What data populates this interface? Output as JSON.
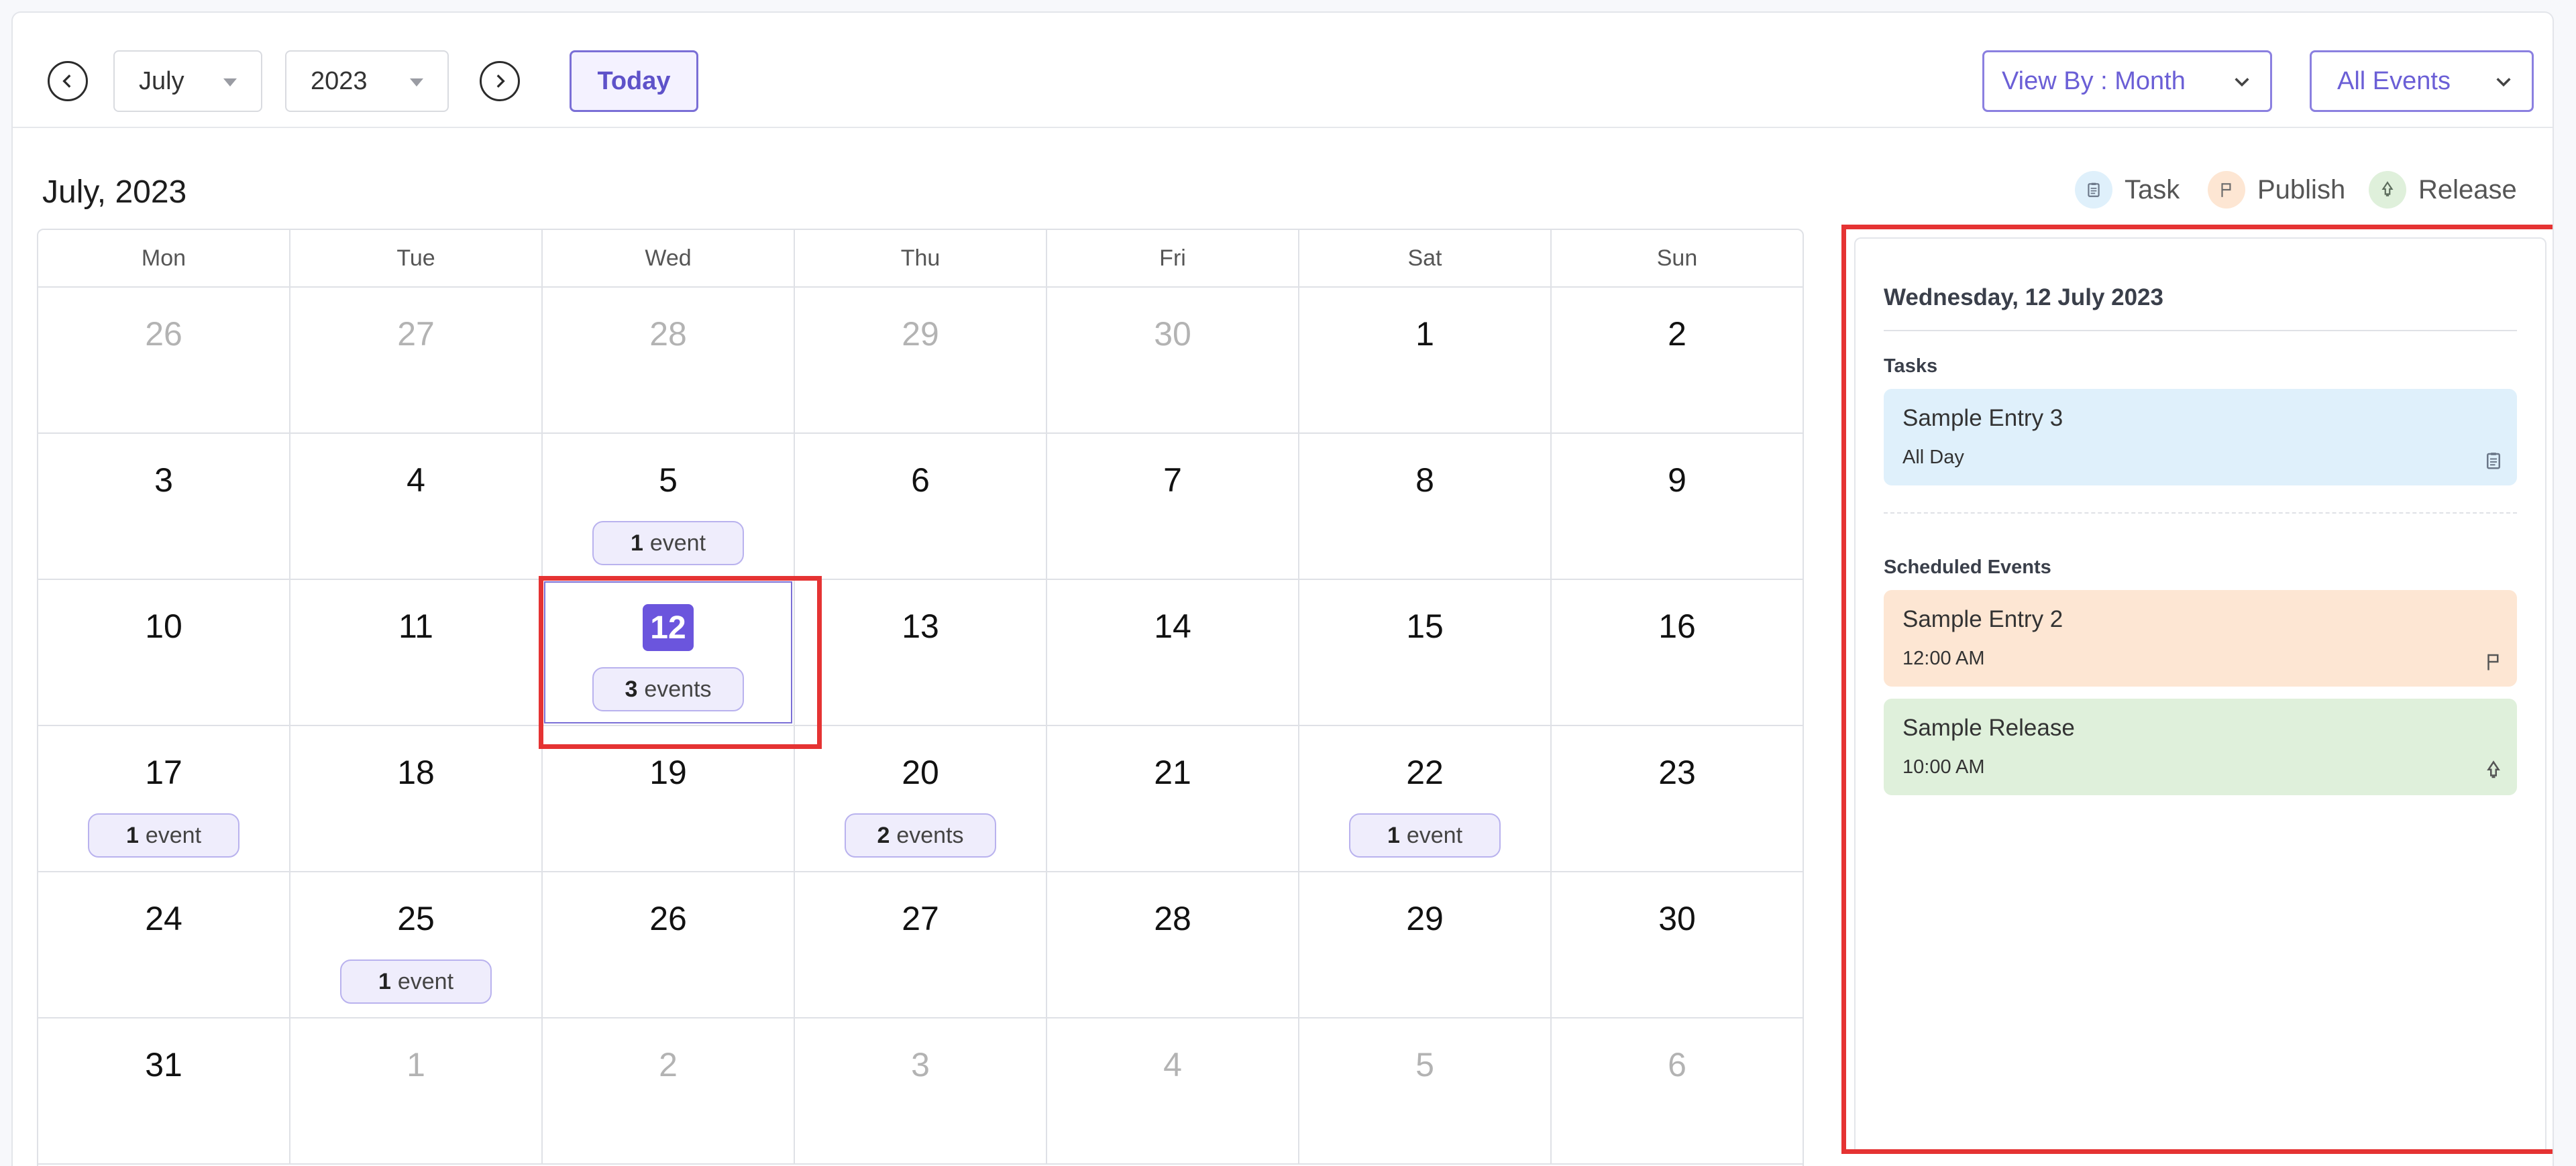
{
  "toolbar": {
    "month_value": "July",
    "year_value": "2023",
    "today_label": "Today",
    "view_by_label": "View By : Month",
    "filter_label": "All Events"
  },
  "header": {
    "title": "July, 2023",
    "legend": [
      {
        "label": "Task",
        "icon": "clipboard-icon",
        "color": "#dff0fb"
      },
      {
        "label": "Publish",
        "icon": "flag-icon",
        "color": "#fde6d3"
      },
      {
        "label": "Release",
        "icon": "rocket-icon",
        "color": "#dff0db"
      }
    ]
  },
  "calendar": {
    "weekdays": [
      "Mon",
      "Tue",
      "Wed",
      "Thu",
      "Fri",
      "Sat",
      "Sun"
    ],
    "weeks": [
      [
        {
          "day": "26",
          "muted": true
        },
        {
          "day": "27",
          "muted": true
        },
        {
          "day": "28",
          "muted": true
        },
        {
          "day": "29",
          "muted": true
        },
        {
          "day": "30",
          "muted": true
        },
        {
          "day": "1"
        },
        {
          "day": "2"
        }
      ],
      [
        {
          "day": "3"
        },
        {
          "day": "4"
        },
        {
          "day": "5",
          "count": "1",
          "unit": "event"
        },
        {
          "day": "6"
        },
        {
          "day": "7"
        },
        {
          "day": "8"
        },
        {
          "day": "9"
        }
      ],
      [
        {
          "day": "10"
        },
        {
          "day": "11"
        },
        {
          "day": "12",
          "count": "3",
          "unit": "events",
          "selected": true
        },
        {
          "day": "13"
        },
        {
          "day": "14"
        },
        {
          "day": "15"
        },
        {
          "day": "16"
        }
      ],
      [
        {
          "day": "17",
          "count": "1",
          "unit": "event"
        },
        {
          "day": "18"
        },
        {
          "day": "19"
        },
        {
          "day": "20",
          "count": "2",
          "unit": "events"
        },
        {
          "day": "21"
        },
        {
          "day": "22",
          "count": "1",
          "unit": "event"
        },
        {
          "day": "23"
        }
      ],
      [
        {
          "day": "24"
        },
        {
          "day": "25",
          "count": "1",
          "unit": "event"
        },
        {
          "day": "26"
        },
        {
          "day": "27"
        },
        {
          "day": "28"
        },
        {
          "day": "29"
        },
        {
          "day": "30"
        }
      ],
      [
        {
          "day": "31"
        },
        {
          "day": "1",
          "muted": true
        },
        {
          "day": "2",
          "muted": true
        },
        {
          "day": "3",
          "muted": true
        },
        {
          "day": "4",
          "muted": true
        },
        {
          "day": "5",
          "muted": true
        },
        {
          "day": "6",
          "muted": true
        }
      ]
    ]
  },
  "panel": {
    "date": "Wednesday, 12 July 2023",
    "tasks_label": "Tasks",
    "tasks": [
      {
        "title": "Sample Entry 3",
        "time": "All Day",
        "color": "#dff0fb",
        "icon": "clipboard-icon"
      }
    ],
    "scheduled_label": "Scheduled Events",
    "scheduled": [
      {
        "title": "Sample Entry 2",
        "time": "12:00 AM",
        "color": "#fde6d3",
        "icon": "flag-icon"
      },
      {
        "title": "Sample Release",
        "time": "10:00 AM",
        "color": "#dff0db",
        "icon": "rocket-icon"
      }
    ]
  }
}
